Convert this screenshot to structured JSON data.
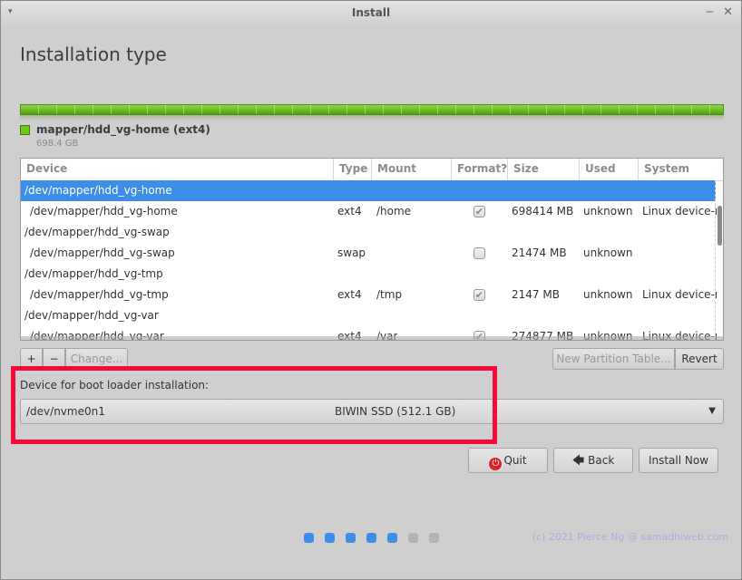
{
  "window": {
    "title": "Install",
    "menu_glyph": "▾",
    "minimize_glyph": "‒",
    "close_glyph": "✕"
  },
  "page": {
    "title": "Installation type"
  },
  "partition_bar": {
    "color": "#72c51b",
    "legend_label": "mapper/hdd_vg-home (ext4)",
    "legend_size": "698.4 GB"
  },
  "table": {
    "columns": [
      "Device",
      "Type",
      "Mount point",
      "Format?",
      "Size",
      "Used",
      "System"
    ],
    "rows": [
      {
        "device": "/dev/mapper/hdd_vg-home",
        "type": "",
        "mount": "",
        "format": null,
        "size": "",
        "used": "",
        "system": "",
        "selected": true,
        "indent": false
      },
      {
        "device": "/dev/mapper/hdd_vg-home",
        "type": "ext4",
        "mount": "/home",
        "format": true,
        "size": "698414 MB",
        "used": "unknown",
        "system": "Linux device-ma",
        "selected": false,
        "indent": true
      },
      {
        "device": "/dev/mapper/hdd_vg-swap",
        "type": "",
        "mount": "",
        "format": null,
        "size": "",
        "used": "",
        "system": "",
        "selected": false,
        "indent": false
      },
      {
        "device": "/dev/mapper/hdd_vg-swap",
        "type": "swap",
        "mount": "",
        "format": false,
        "size": "21474 MB",
        "used": "unknown",
        "system": "",
        "selected": false,
        "indent": true
      },
      {
        "device": "/dev/mapper/hdd_vg-tmp",
        "type": "",
        "mount": "",
        "format": null,
        "size": "",
        "used": "",
        "system": "",
        "selected": false,
        "indent": false
      },
      {
        "device": "/dev/mapper/hdd_vg-tmp",
        "type": "ext4",
        "mount": "/tmp",
        "format": true,
        "size": "2147 MB",
        "used": "unknown",
        "system": "Linux device-ma",
        "selected": false,
        "indent": true
      },
      {
        "device": "/dev/mapper/hdd_vg-var",
        "type": "",
        "mount": "",
        "format": null,
        "size": "",
        "used": "",
        "system": "",
        "selected": false,
        "indent": false
      },
      {
        "device": "/dev/mapper/hdd_vg-var",
        "type": "ext4",
        "mount": "/var",
        "format": true,
        "size": "274877 MB",
        "used": "unknown",
        "system": "Linux device-ma",
        "selected": false,
        "indent": true
      }
    ]
  },
  "toolbar": {
    "add_label": "+",
    "remove_label": "−",
    "change_label": "Change...",
    "new_table_label": "New Partition Table...",
    "revert_label": "Revert"
  },
  "bootloader": {
    "label": "Device for boot loader installation:",
    "selected_device": "/dev/nvme0n1",
    "selected_model": "BIWIN SSD (512.1 GB)",
    "arrow_glyph": "▼"
  },
  "buttons": {
    "quit_label": "Quit",
    "quit_icon": "⏻",
    "back_label": "Back",
    "back_icon": "🡄",
    "install_label": "Install Now"
  },
  "progress": {
    "total_steps": 7,
    "completed_steps": 5
  },
  "annotation": {
    "highlight_color": "#f5083a"
  },
  "credit": "(c) 2021 Pierce Ng @ samadhiweb.com"
}
